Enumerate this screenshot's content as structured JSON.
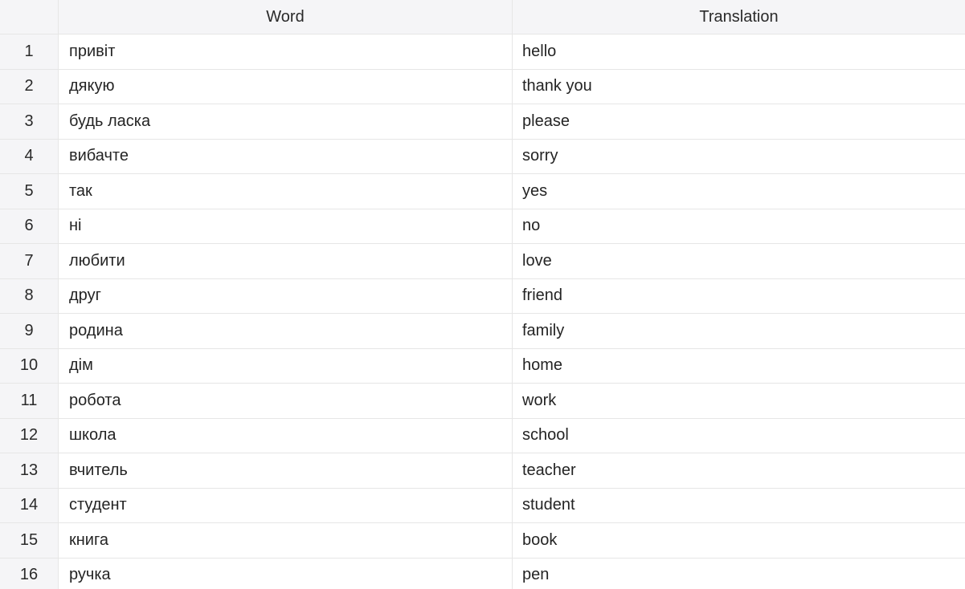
{
  "table": {
    "columns": [
      "",
      "Word",
      "Translation"
    ],
    "rows": [
      {
        "index": "1",
        "word": "привіт",
        "translation": "hello"
      },
      {
        "index": "2",
        "word": "дякую",
        "translation": "thank you"
      },
      {
        "index": "3",
        "word": "будь ласка",
        "translation": "please"
      },
      {
        "index": "4",
        "word": "вибачте",
        "translation": "sorry"
      },
      {
        "index": "5",
        "word": "так",
        "translation": "yes"
      },
      {
        "index": "6",
        "word": "ні",
        "translation": "no"
      },
      {
        "index": "7",
        "word": "любити",
        "translation": "love"
      },
      {
        "index": "8",
        "word": "друг",
        "translation": "friend"
      },
      {
        "index": "9",
        "word": "родина",
        "translation": "family"
      },
      {
        "index": "10",
        "word": "дім",
        "translation": "home"
      },
      {
        "index": "11",
        "word": "робота",
        "translation": "work"
      },
      {
        "index": "12",
        "word": "школа",
        "translation": "school"
      },
      {
        "index": "13",
        "word": "вчитель",
        "translation": "teacher"
      },
      {
        "index": "14",
        "word": "студент",
        "translation": "student"
      },
      {
        "index": "15",
        "word": "книга",
        "translation": "book"
      },
      {
        "index": "16",
        "word": "ручка",
        "translation": "pen"
      }
    ]
  }
}
